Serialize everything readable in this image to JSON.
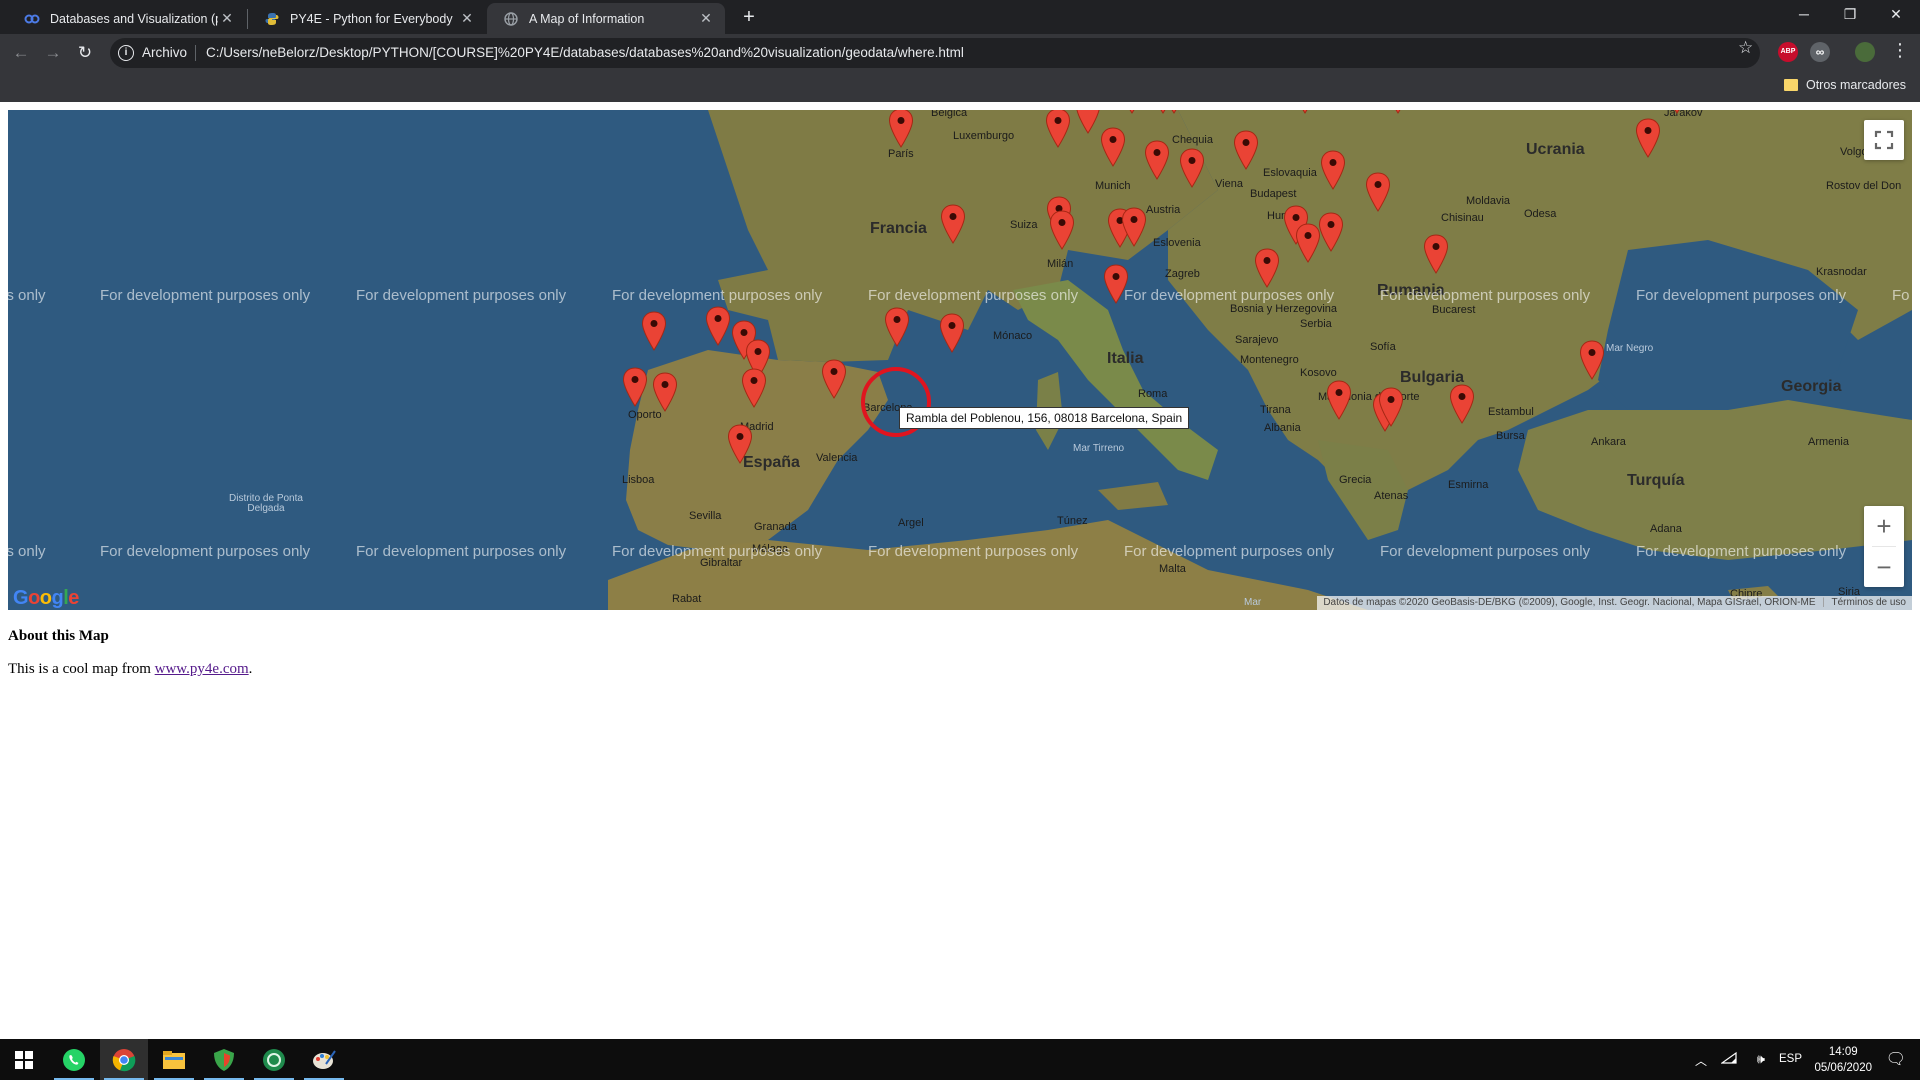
{
  "browser": {
    "tabs": [
      {
        "title": "Databases and Visualization (pee",
        "icon": "coursera-icon",
        "active": false
      },
      {
        "title": "PY4E - Python for Everybody",
        "icon": "python-icon",
        "active": false
      },
      {
        "title": "A Map of Information",
        "icon": "globe-icon",
        "active": true
      }
    ],
    "omnibox": {
      "scheme_label": "Archivo",
      "url": "C:/Users/neBelorz/Desktop/PYTHON/[COURSE]%20PY4E/databases/databases%20and%20visualization/geodata/where.html"
    },
    "extensions": [
      {
        "label": "ABP",
        "color": "#c70d2c"
      },
      {
        "label": "∞",
        "color": "#5f6368"
      }
    ],
    "bookmarks": {
      "other_label": "Otros marcadores"
    }
  },
  "map": {
    "watermark": "For development purposes only",
    "tooltip": "Rambla del Poblenou, 156, 08018 Barcelona, Spain",
    "attribution": "Datos de mapas ©2020 GeoBasis-DE/BKG (©2009), Google, Inst. Geogr. Nacional, Mapa GISrael, ORION-ME",
    "terms": "Términos de uso",
    "logo": "Google",
    "zoom_in": "+",
    "zoom_out": "−",
    "labels": [
      {
        "text": "Bélgica",
        "cls": ""
      },
      {
        "text": "Luxemburgo",
        "cls": ""
      },
      {
        "text": "Francia",
        "cls": "big"
      },
      {
        "text": "Suiza",
        "cls": ""
      },
      {
        "text": "Chequia",
        "cls": ""
      },
      {
        "text": "Eslovaquia",
        "cls": ""
      },
      {
        "text": "Austria",
        "cls": ""
      },
      {
        "text": "Budapest",
        "cls": ""
      },
      {
        "text": "Hungría",
        "cls": ""
      },
      {
        "text": "Eslovenia",
        "cls": ""
      },
      {
        "text": "Ucrania",
        "cls": "big"
      },
      {
        "text": "Moldavia",
        "cls": ""
      },
      {
        "text": "Chisinau",
        "cls": ""
      },
      {
        "text": "Odesa",
        "cls": ""
      },
      {
        "text": "Rumania",
        "cls": "big"
      },
      {
        "text": "Bucarest",
        "cls": ""
      },
      {
        "text": "Volgogr",
        "cls": ""
      },
      {
        "text": "Rostov del Don",
        "cls": ""
      },
      {
        "text": "Krasnodar",
        "cls": ""
      },
      {
        "text": "Mónaco",
        "cls": ""
      },
      {
        "text": "Italia",
        "cls": "big"
      },
      {
        "text": "Roma",
        "cls": ""
      },
      {
        "text": "Serbia",
        "cls": ""
      },
      {
        "text": "Bosnia y Herzegovina",
        "cls": ""
      },
      {
        "text": "Sarajevo",
        "cls": ""
      },
      {
        "text": "Montenegro",
        "cls": ""
      },
      {
        "text": "Kosovo",
        "cls": ""
      },
      {
        "text": "Sofía",
        "cls": ""
      },
      {
        "text": "Bulgaria",
        "cls": "big"
      },
      {
        "text": "Macedonia del Norte",
        "cls": ""
      },
      {
        "text": "Tirana",
        "cls": ""
      },
      {
        "text": "Albania",
        "cls": ""
      },
      {
        "text": "Mar Negro",
        "cls": "sea"
      },
      {
        "text": "Georgia",
        "cls": "big"
      },
      {
        "text": "Armenia",
        "cls": ""
      },
      {
        "text": "Estambul",
        "cls": ""
      },
      {
        "text": "Bursa",
        "cls": ""
      },
      {
        "text": "Ankara",
        "cls": ""
      },
      {
        "text": "Turquía",
        "cls": "big"
      },
      {
        "text": "Esmirna",
        "cls": ""
      },
      {
        "text": "Adana",
        "cls": ""
      },
      {
        "text": "Grecia",
        "cls": ""
      },
      {
        "text": "Atenas",
        "cls": ""
      },
      {
        "text": "Mar Tirreno",
        "cls": "sea"
      },
      {
        "text": "Oporto",
        "cls": ""
      },
      {
        "text": "Madrid",
        "cls": ""
      },
      {
        "text": "España",
        "cls": "big"
      },
      {
        "text": "Valencia",
        "cls": ""
      },
      {
        "text": "Barcelona",
        "cls": ""
      },
      {
        "text": "Lisboa",
        "cls": ""
      },
      {
        "text": "Distrito de Ponta Delgada",
        "cls": "sea"
      },
      {
        "text": "Sevilla",
        "cls": ""
      },
      {
        "text": "Granada",
        "cls": ""
      },
      {
        "text": "Málaga",
        "cls": ""
      },
      {
        "text": "Gibraltar",
        "cls": ""
      },
      {
        "text": "Argel",
        "cls": ""
      },
      {
        "text": "Túnez",
        "cls": ""
      },
      {
        "text": "Malta",
        "cls": ""
      },
      {
        "text": "Rabat",
        "cls": ""
      },
      {
        "text": "Chipre",
        "cls": ""
      },
      {
        "text": "Siria",
        "cls": ""
      },
      {
        "text": "Mar",
        "cls": "sea"
      },
      {
        "text": "Munich",
        "cls": ""
      },
      {
        "text": "Viena",
        "cls": ""
      },
      {
        "text": "Milán",
        "cls": ""
      },
      {
        "text": "París",
        "cls": ""
      },
      {
        "text": "Zagreb",
        "cls": ""
      },
      {
        "text": "Jarákov",
        "cls": ""
      }
    ],
    "marker_count": 44
  },
  "about": {
    "title": "About this Map",
    "text_before": "This is a cool map from ",
    "link": "www.py4e.com",
    "text_after": "."
  },
  "taskbar": {
    "language": "ESP",
    "time": "14:09",
    "date": "05/06/2020"
  }
}
